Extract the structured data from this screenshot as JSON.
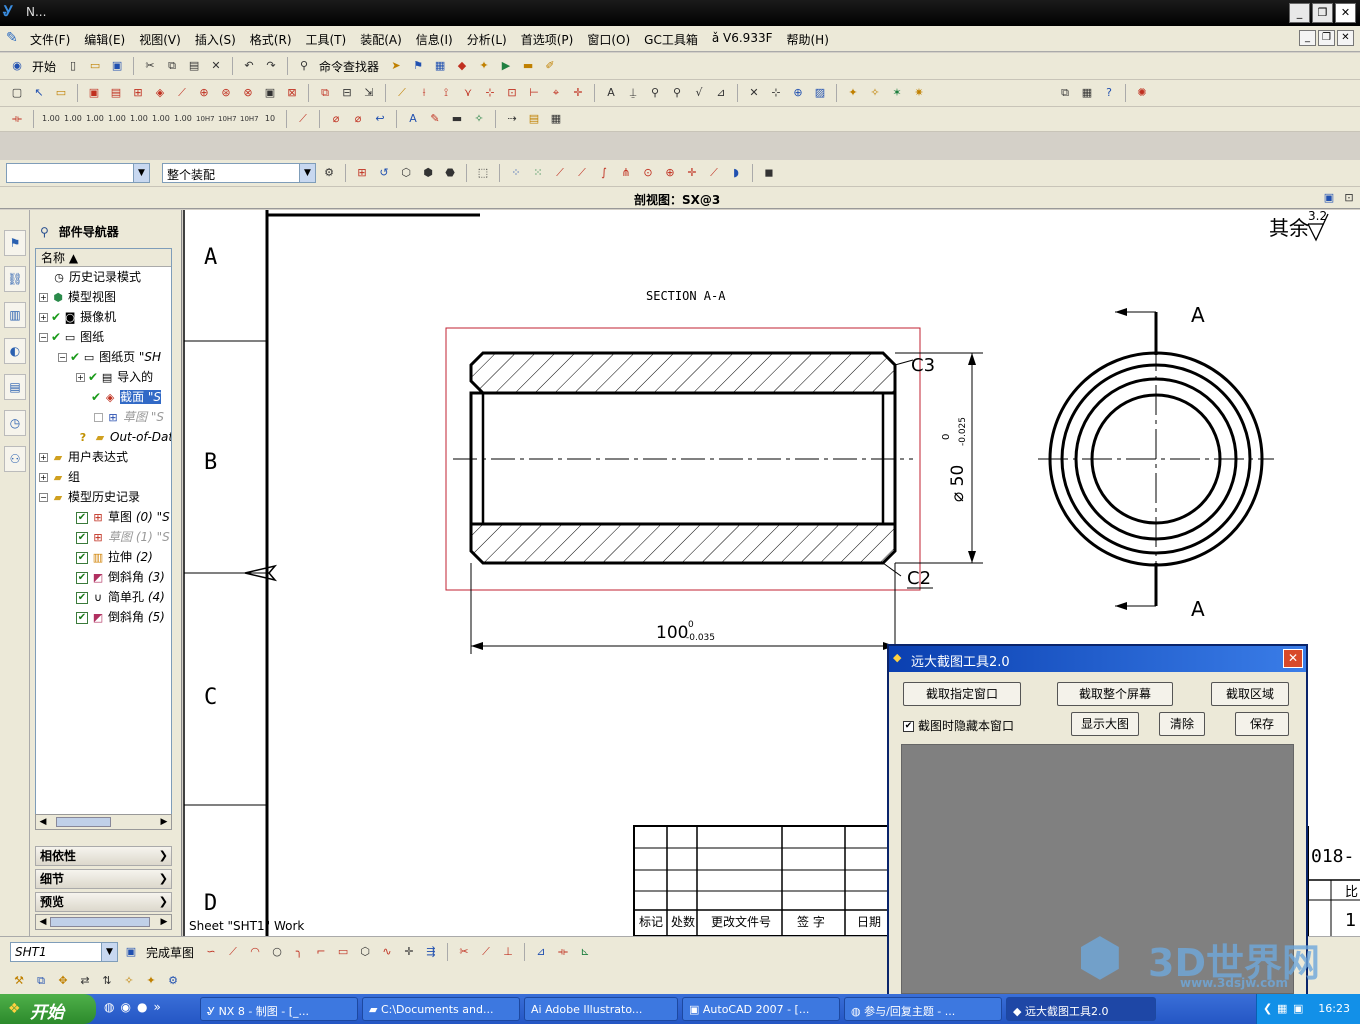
{
  "window": {
    "title": "N...",
    "controls": [
      "_",
      "❐",
      "✕"
    ]
  },
  "menu": {
    "items": [
      "文件(F)",
      "编辑(E)",
      "视图(V)",
      "插入(S)",
      "格式(R)",
      "工具(T)",
      "装配(A)",
      "信息(I)",
      "分析(L)",
      "首选项(P)",
      "窗口(O)",
      "GC工具箱",
      "ǎ V6.933F",
      "帮助(H)"
    ]
  },
  "toolbar1": {
    "start_label": "开始",
    "command_finder_label": "命令查找器"
  },
  "toolbar4": {
    "filter_value": "",
    "scope_value": "整个装配"
  },
  "dim_toolbar": {
    "labels": [
      "1.00",
      "1.00",
      "1.00",
      "1.00",
      "1.00",
      "1.00",
      "1.00",
      "10H7",
      "10H7",
      "10H7",
      "10"
    ]
  },
  "view_caption": "剖视图：SX@3",
  "navigator": {
    "title": "部件导航器",
    "column": "名称",
    "nodes": [
      {
        "label": "历史记录模式",
        "extra": ""
      },
      {
        "label": "模型视图",
        "extra": ""
      },
      {
        "label": "摄像机",
        "extra": ""
      },
      {
        "label": "图纸",
        "extra": ""
      },
      {
        "label": "图纸页",
        "extra": "\"SH"
      },
      {
        "label": "导入的",
        "extra": ""
      },
      {
        "label": "截面",
        "extra": "\"S"
      },
      {
        "label": "草图",
        "extra": "\"S"
      },
      {
        "label": "Out-of-Dat",
        "extra": ""
      },
      {
        "label": "用户表达式",
        "extra": ""
      },
      {
        "label": "组",
        "extra": ""
      },
      {
        "label": "模型历史记录",
        "extra": ""
      },
      {
        "label": "草图",
        "extra": "(0) \"S"
      },
      {
        "label": "草图",
        "extra": "(1) \"S"
      },
      {
        "label": "拉伸",
        "extra": "(2)"
      },
      {
        "label": "倒斜角",
        "extra": "(3)"
      },
      {
        "label": "简单孔",
        "extra": "(4)"
      },
      {
        "label": "倒斜角",
        "extra": "(5)"
      }
    ],
    "panels": [
      "相依性",
      "细节",
      "预览"
    ]
  },
  "drawing": {
    "zones": [
      "A",
      "B",
      "C",
      "D"
    ],
    "section_title": "SECTION A-A",
    "roughness": "其余",
    "roughness_value": "3.2",
    "chamfer_top": "C3",
    "chamfer_bottom": "C2",
    "dia_dim": "⌀ 50",
    "dia_tol_upper": "0",
    "dia_tol_lower": "-0.025",
    "len_dim": "100",
    "len_tol_upper": "0",
    "len_tol_lower": "-0.035",
    "cut_label_top": "A",
    "cut_label_bottom": "A",
    "sheet_label": "Sheet \"SHT1\" Work",
    "title_block_headers": [
      "标记",
      "处数",
      "更改文件号",
      "签  字",
      "日期"
    ],
    "title_block_right": "018-",
    "title_block_corner": "比",
    "title_block_num": "1"
  },
  "bottom_toolbar": {
    "sheet_value": "SHT1",
    "finish_sketch_label": "完成草图"
  },
  "dialog": {
    "title": "远大截图工具2.0",
    "btn_capture_window": "截取指定窗口",
    "btn_capture_screen": "截取整个屏幕",
    "btn_capture_region": "截取区域",
    "chk_hide_label": "截图时隐藏本窗口",
    "chk_hide_checked": true,
    "btn_show_large": "显示大图",
    "btn_clear": "清除",
    "btn_save": "保存"
  },
  "taskbar": {
    "start_label": "开始",
    "tasks": [
      "NX 8 - 制图 - [_...",
      "C:\\Documents and...",
      "Adobe Illustrato...",
      "AutoCAD 2007 - [...",
      "参与/回复主题 - ...",
      "远大截图工具2.0"
    ],
    "clock": "16:23"
  },
  "watermark": {
    "brand": "3D世界网",
    "url": "www.3dsjw.com"
  }
}
